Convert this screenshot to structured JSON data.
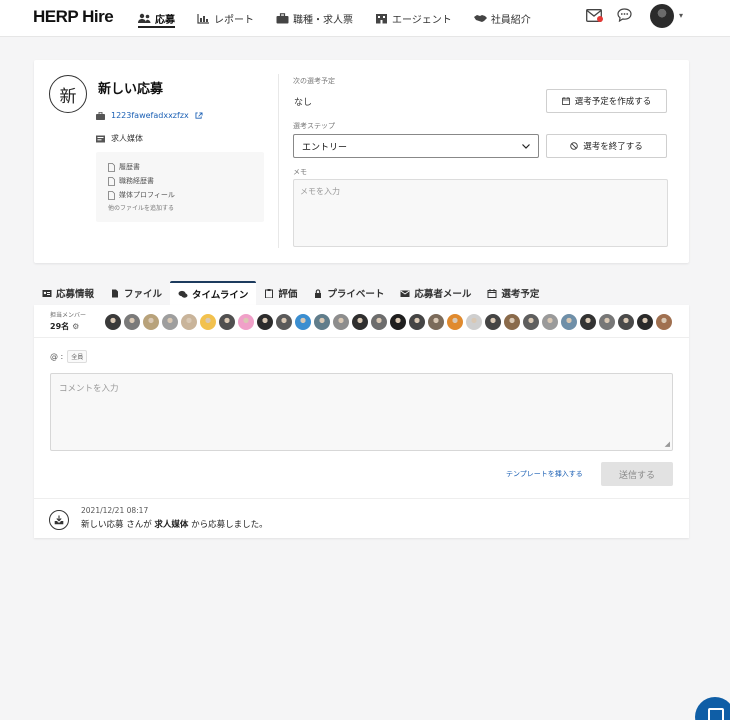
{
  "header": {
    "logo": "HERP Hire",
    "nav": [
      {
        "label": "応募",
        "icon": "people-icon",
        "active": true
      },
      {
        "label": "レポート",
        "icon": "bar-chart-icon",
        "active": false
      },
      {
        "label": "職種・求人票",
        "icon": "briefcase-icon",
        "active": false
      },
      {
        "label": "エージェント",
        "icon": "building-icon",
        "active": false
      },
      {
        "label": "社員紹介",
        "icon": "handshake-icon",
        "active": false
      }
    ],
    "notification_color": "#e53935"
  },
  "applicant": {
    "avatar_char": "新",
    "name": "新しい応募",
    "link_text": "1223fawefadxxzfzx",
    "media": "求人媒体",
    "files": [
      "履歴書",
      "職務経歴書",
      "媒体プロフィール"
    ],
    "files_note": "他のファイルを追加する"
  },
  "selection": {
    "next_label": "次の選考予定",
    "next_value": "なし",
    "create_btn": "選考予定を作成する",
    "step_label": "選考ステップ",
    "step_value": "エントリー",
    "end_btn": "選考を終了する",
    "memo_label": "メモ",
    "memo_placeholder": "メモを入力"
  },
  "tabs": [
    {
      "label": "応募情報",
      "icon": "id-card-icon"
    },
    {
      "label": "ファイル",
      "icon": "file-icon"
    },
    {
      "label": "タイムライン",
      "icon": "comments-icon",
      "active": true
    },
    {
      "label": "評価",
      "icon": "clipboard-icon"
    },
    {
      "label": "プライベート",
      "icon": "lock-icon"
    },
    {
      "label": "応募者メール",
      "icon": "envelope-icon"
    },
    {
      "label": "選考予定",
      "icon": "calendar-icon"
    }
  ],
  "timeline": {
    "members_label": "担当メンバー",
    "members_count": "29名",
    "mention_symbol": "@ :",
    "mention_tag": "全員",
    "comment_placeholder": "コメントを入力",
    "template_link": "テンプレートを挿入する",
    "send_btn": "送信する",
    "event": {
      "time": "2021/12/21 08:17",
      "name": "新しい応募",
      "mid": " さんが ",
      "media": "求人媒体",
      "tail": " から応募しました。"
    }
  },
  "member_colors": [
    "#3a3a3a",
    "#7a7a7a",
    "#b8a27a",
    "#9e9e9e",
    "#c9b49a",
    "#f2c14e",
    "#505050",
    "#f0a0c8",
    "#2c2c2c",
    "#5a5a5a",
    "#3b8ed0",
    "#607d8b",
    "#8d8d8d",
    "#2f2f2f",
    "#6d6d6d",
    "#1f1f1f",
    "#444",
    "#7b6b5a",
    "#e08a2e",
    "#cfcfcf",
    "#444444",
    "#8a6a4a",
    "#5e5e5e",
    "#9a9a9a",
    "#6f8fa8",
    "#333",
    "#777",
    "#4a4a4a",
    "#2a2a2a",
    "#a07050"
  ]
}
